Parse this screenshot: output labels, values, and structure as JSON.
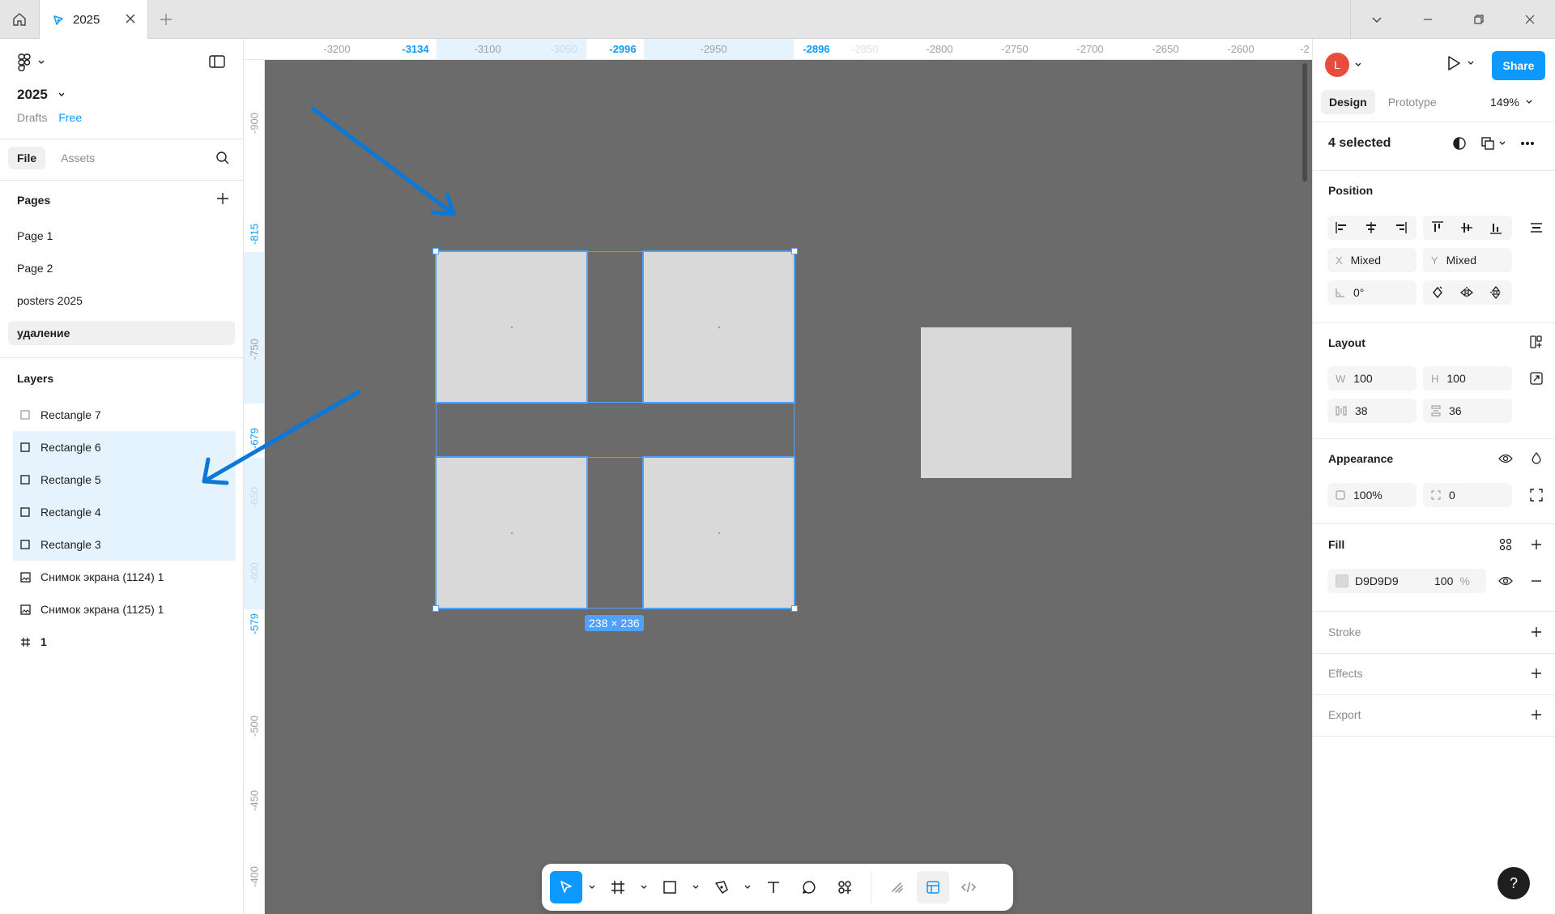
{
  "tabbar": {
    "tab_title": "2025",
    "add_tab_symbol": "+"
  },
  "left": {
    "file_name": "2025",
    "drafts": "Drafts",
    "plan": "Free",
    "tabs": [
      "File",
      "Assets"
    ],
    "pages_title": "Pages",
    "pages": [
      "Page 1",
      "Page 2",
      "posters 2025",
      "удаление"
    ],
    "layers_title": "Layers",
    "layers": [
      {
        "name": "Rectangle 7",
        "icon": "rectangle-icon"
      },
      {
        "name": "Rectangle 6",
        "icon": "rectangle-icon"
      },
      {
        "name": "Rectangle 5",
        "icon": "rectangle-icon"
      },
      {
        "name": "Rectangle 4",
        "icon": "rectangle-icon"
      },
      {
        "name": "Rectangle 3",
        "icon": "rectangle-icon"
      },
      {
        "name": "Снимок экрана (1124) 1",
        "icon": "image-icon"
      },
      {
        "name": "Снимок экрана (1125) 1",
        "icon": "image-icon"
      },
      {
        "name": "1",
        "icon": "frame-icon"
      }
    ]
  },
  "rulers": {
    "top": [
      "-3200",
      "-3134",
      "-3100",
      "-3050",
      "-2996",
      "-2950",
      "-2896",
      "-2850",
      "-2800",
      "-2750",
      "-2700",
      "-2650",
      "-2600",
      "-2"
    ],
    "left": [
      "-900",
      "-815",
      "-750",
      "-679",
      "-650",
      "-600",
      "-579",
      "-500",
      "-450",
      "-400"
    ]
  },
  "canvas": {
    "selection_size": "238 × 236",
    "rect_fill": "#D9D9D9",
    "canvas_bg": "#6B6B6B",
    "selection_color": "#4FA0FF",
    "annotation_arrow_color": "#0A78D8"
  },
  "right": {
    "avatar_initial": "L",
    "share": "Share",
    "tabs": [
      "Design",
      "Prototype"
    ],
    "zoom": "149%",
    "selected": "4 selected",
    "position_title": "Position",
    "x_label": "X",
    "x_value": "Mixed",
    "y_label": "Y",
    "y_value": "Mixed",
    "rotation": "0°",
    "layout_title": "Layout",
    "w_label": "W",
    "w_value": "100",
    "h_label": "H",
    "h_value": "100",
    "gap_h": "38",
    "gap_v": "36",
    "appearance_title": "Appearance",
    "opacity": "100%",
    "radius": "0",
    "fill_title": "Fill",
    "fill_hex": "D9D9D9",
    "fill_opacity": "100",
    "fill_pct": "%",
    "stroke_title": "Stroke",
    "effects_title": "Effects",
    "export_title": "Export",
    "help": "?"
  }
}
